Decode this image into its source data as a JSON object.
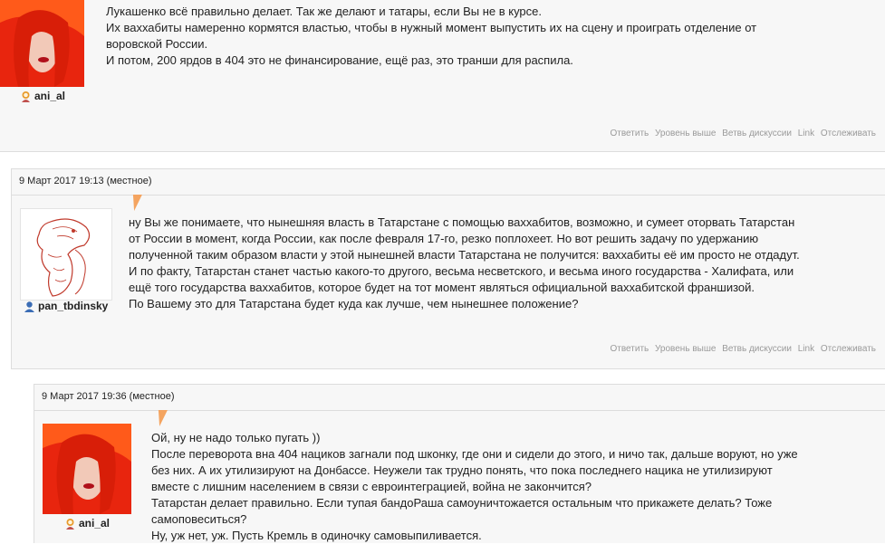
{
  "comments": [
    {
      "username": "ani_al",
      "date": "",
      "lines": [
        "Лукашенко всё правильно делает. Так же делают и татары, если Вы не в курсе.",
        "Их ваххабиты намеренно кормятся властью, чтобы в нужный момент выпустить их на сцену и проиграть отделение от",
        "воровской России.",
        "И потом, 200 ярдов в 404 это не финансирование, ещё раз, это транши для распила."
      ],
      "actions": [
        "Ответить",
        "Уровень выше",
        "Ветвь дискуссии",
        "Link",
        "Отслеживать"
      ]
    },
    {
      "username": "pan_tbdinsky",
      "date": "9 Март 2017 19:13 (местное)",
      "lines": [
        "ну Вы же понимаете, что нынешняя власть в Татарстане с помощью ваххабитов, возможно, и сумеет оторвать Татарстан",
        "от России в момент, когда России, как после февраля 17-го, резко поплохеет. Но вот решить задачу по удержанию",
        "полученной таким образом власти у этой нынешней власти Татарстана не получится: ваххабиты её им просто не отдадут.",
        "И по факту, Татарстан станет частью какого-то другого, весьма несветского, и весьма иного государства - Халифата, или",
        "ещё того государства ваххабитов, которое будет на тот момент являться официальной ваххабитской франшизой.",
        "По Вашему это для Татарстана будет куда как лучше, чем нынешнее положение?"
      ],
      "actions": [
        "Ответить",
        "Уровень выше",
        "Ветвь дискуссии",
        "Link",
        "Отслеживать"
      ]
    },
    {
      "username": "ani_al",
      "date": "9 Март 2017 19:36 (местное)",
      "lines": [
        "Ой, ну не надо только пугать ))",
        "После переворота вна 404 нациков загнали под шконку, где они и сидели до этого, и ничо так, дальше воруют, но уже",
        "без них. А их утилизируют на Донбассе. Неужели так трудно понять, что пока последнего нацика не утилизируют",
        "вместе с лишним населением в связи с евроинтеграцией, война не закончится?",
        "Татарстан делает правильно. Если тупая бандоРаша самоуничтожается остальным что прикажете делать? Тоже",
        "самоповеситься?",
        "Ну, уж нет, уж. Пусть Кремль в одиночку самовыпиливается."
      ],
      "actions": []
    }
  ]
}
